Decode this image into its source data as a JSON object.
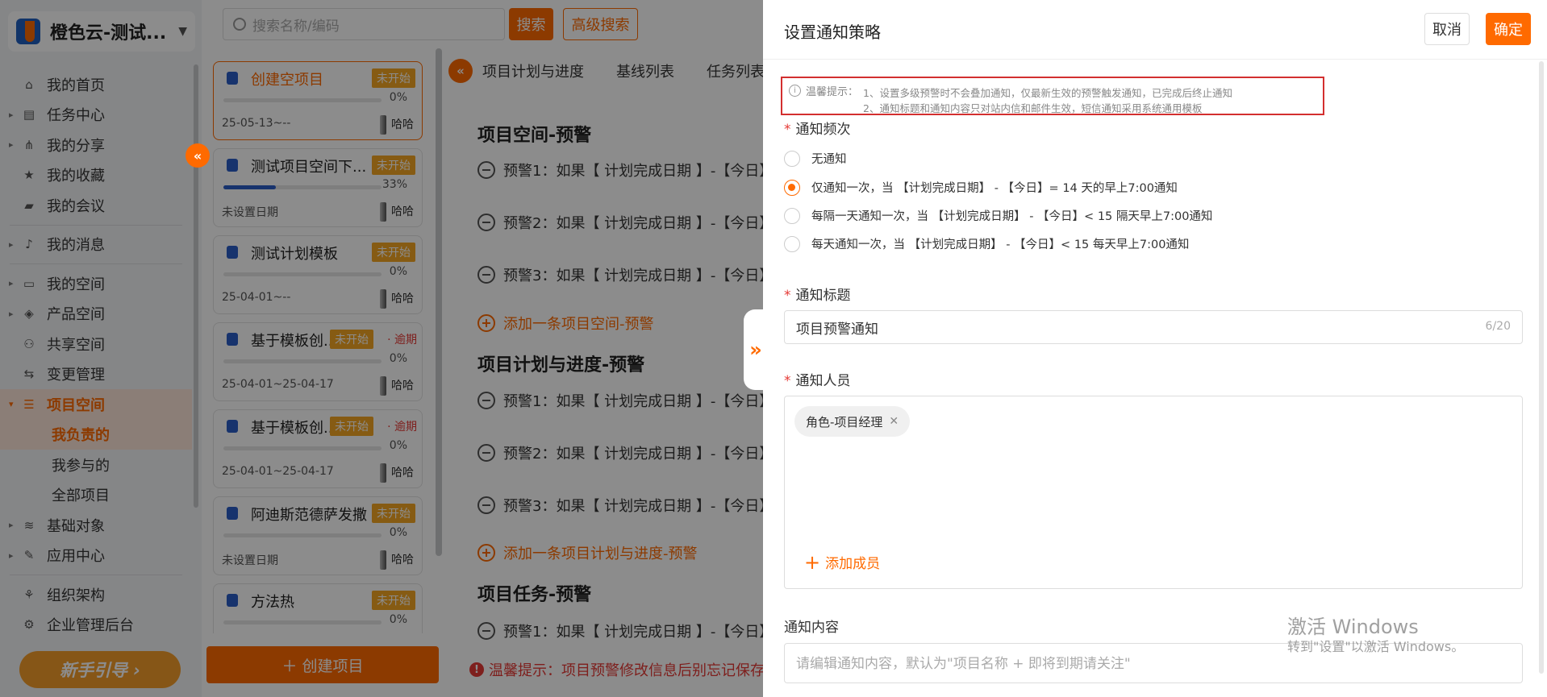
{
  "sidebar": {
    "brand": "橙色云-测试...",
    "items": [
      {
        "label": "我的首页",
        "icon": "home-icon",
        "glyph": "⌂",
        "arrow": ""
      },
      {
        "label": "任务中心",
        "icon": "clipboard-icon",
        "glyph": "▤",
        "arrow": "▸"
      },
      {
        "label": "我的分享",
        "icon": "share-icon",
        "glyph": "⋔",
        "arrow": "▸"
      },
      {
        "label": "我的收藏",
        "icon": "star-icon",
        "glyph": "★",
        "arrow": ""
      },
      {
        "label": "我的会议",
        "icon": "video-icon",
        "glyph": "▰",
        "arrow": ""
      },
      {
        "label": "我的消息",
        "icon": "bell-icon",
        "glyph": "♪",
        "arrow": "▸"
      },
      {
        "label": "我的空间",
        "icon": "folder-icon",
        "glyph": "▭",
        "arrow": "▸"
      },
      {
        "label": "产品空间",
        "icon": "cube-icon",
        "glyph": "◈",
        "arrow": "▸"
      },
      {
        "label": "共享空间",
        "icon": "users-icon",
        "glyph": "⚇",
        "arrow": ""
      },
      {
        "label": "变更管理",
        "icon": "swap-icon",
        "glyph": "⇆",
        "arrow": ""
      },
      {
        "label": "项目空间",
        "icon": "database-icon",
        "glyph": "☰",
        "arrow": "▾"
      },
      {
        "label": "我负责的"
      },
      {
        "label": "我参与的"
      },
      {
        "label": "全部项目"
      },
      {
        "label": "基础对象",
        "icon": "layers-icon",
        "glyph": "≋",
        "arrow": "▸"
      },
      {
        "label": "应用中心",
        "icon": "apps-icon",
        "glyph": "✎",
        "arrow": "▸"
      },
      {
        "label": "组织架构",
        "icon": "org-icon",
        "glyph": "⚘",
        "arrow": ""
      },
      {
        "label": "企业管理后台",
        "icon": "settings-icon",
        "glyph": "⚙",
        "arrow": ""
      }
    ],
    "guide": "新手引导 ›"
  },
  "search": {
    "placeholder": "搜索名称/编码",
    "search_label": "搜索",
    "advanced_label": "高级搜索"
  },
  "projects": [
    {
      "name": "创建空项目",
      "status": "未开始",
      "progress_pct": 0,
      "progress_text": "0%",
      "date": "25-05-13~--",
      "owner": "哈哈",
      "overdue": ""
    },
    {
      "name": "测试项目空间下...",
      "status": "未开始",
      "progress_pct": 33,
      "progress_text": "33%",
      "date": "未设置日期",
      "owner": "哈哈",
      "overdue": ""
    },
    {
      "name": "测试计划模板",
      "status": "未开始",
      "progress_pct": 0,
      "progress_text": "0%",
      "date": "25-04-01~--",
      "owner": "哈哈",
      "overdue": ""
    },
    {
      "name": "基于模板创...",
      "status": "未开始",
      "progress_pct": 0,
      "progress_text": "0%",
      "date": "25-04-01~25-04-17",
      "owner": "哈哈",
      "overdue": "· 逾期"
    },
    {
      "name": "基于模板创...",
      "status": "未开始",
      "progress_pct": 0,
      "progress_text": "0%",
      "date": "25-04-01~25-04-17",
      "owner": "哈哈",
      "overdue": "· 逾期"
    },
    {
      "name": "阿迪斯范德萨发撒",
      "status": "未开始",
      "progress_pct": 0,
      "progress_text": "0%",
      "date": "未设置日期",
      "owner": "哈哈",
      "overdue": ""
    },
    {
      "name": "方法热",
      "status": "未开始",
      "progress_pct": 0,
      "progress_text": "0%",
      "date": "",
      "owner": "",
      "overdue": ""
    }
  ],
  "create_project": "＋  创建项目",
  "main": {
    "tabs": [
      "项目计划与进度",
      "基线列表",
      "任务列表"
    ],
    "sections": [
      {
        "title": "项目空间-预警",
        "rows": [
          "预警1：如果【 计划完成日期 】-【今日】",
          "预警2：如果【 计划完成日期 】-【今日】",
          "预警3：如果【 计划完成日期 】-【今日】"
        ],
        "add": "添加一条项目空间-预警"
      },
      {
        "title": "项目计划与进度-预警",
        "rows": [
          "预警1：如果【 计划完成日期 】-【今日】",
          "预警2：如果【 计划完成日期 】-【今日】",
          "预警3：如果【 计划完成日期 】-【今日】"
        ],
        "add": "添加一条项目计划与进度-预警"
      },
      {
        "title": "项目任务-预警",
        "rows": [
          "预警1：如果【 计划完成日期 】-【今日】"
        ],
        "add": ""
      }
    ],
    "footer_tip": "温馨提示：项目预警修改信息后别忘记保存"
  },
  "drawer": {
    "title": "设置通知策略",
    "cancel": "取消",
    "ok": "确定",
    "tip_label": "温馨提示：",
    "tip_line1": "1、设置多级预警时不会叠加通知，仅最新生效的预警触发通知，已完成后终止通知",
    "tip_line2": "2、通知标题和通知内容只对站内信和邮件生效，短信通知采用系统通用模板",
    "freq_label": "通知频次",
    "freq_options": [
      "无通知",
      "仅通知一次，当 【计划完成日期】 - 【今日】= 14 天的早上7:00通知",
      "每隔一天通知一次，当 【计划完成日期】 - 【今日】< 15 隔天早上7:00通知",
      "每天通知一次，当 【计划完成日期】 - 【今日】< 15 每天早上7:00通知"
    ],
    "freq_selected": 1,
    "title_label": "通知标题",
    "title_value": "项目预警通知",
    "title_count": "6/20",
    "members_label": "通知人员",
    "member_tag": "角色-项目经理",
    "add_member": "添加成员",
    "content_label": "通知内容",
    "content_placeholder": "请编辑通知内容，默认为\"项目名称 + 即将到期请关注\""
  },
  "watermark": {
    "line1": "激活 Windows",
    "line2": "转到\"设置\"以激活 Windows。"
  },
  "colors": {
    "accent": "#ff6a00",
    "alert": "#e53935",
    "status": "#f5a623",
    "progress": "#2b5ec7"
  }
}
